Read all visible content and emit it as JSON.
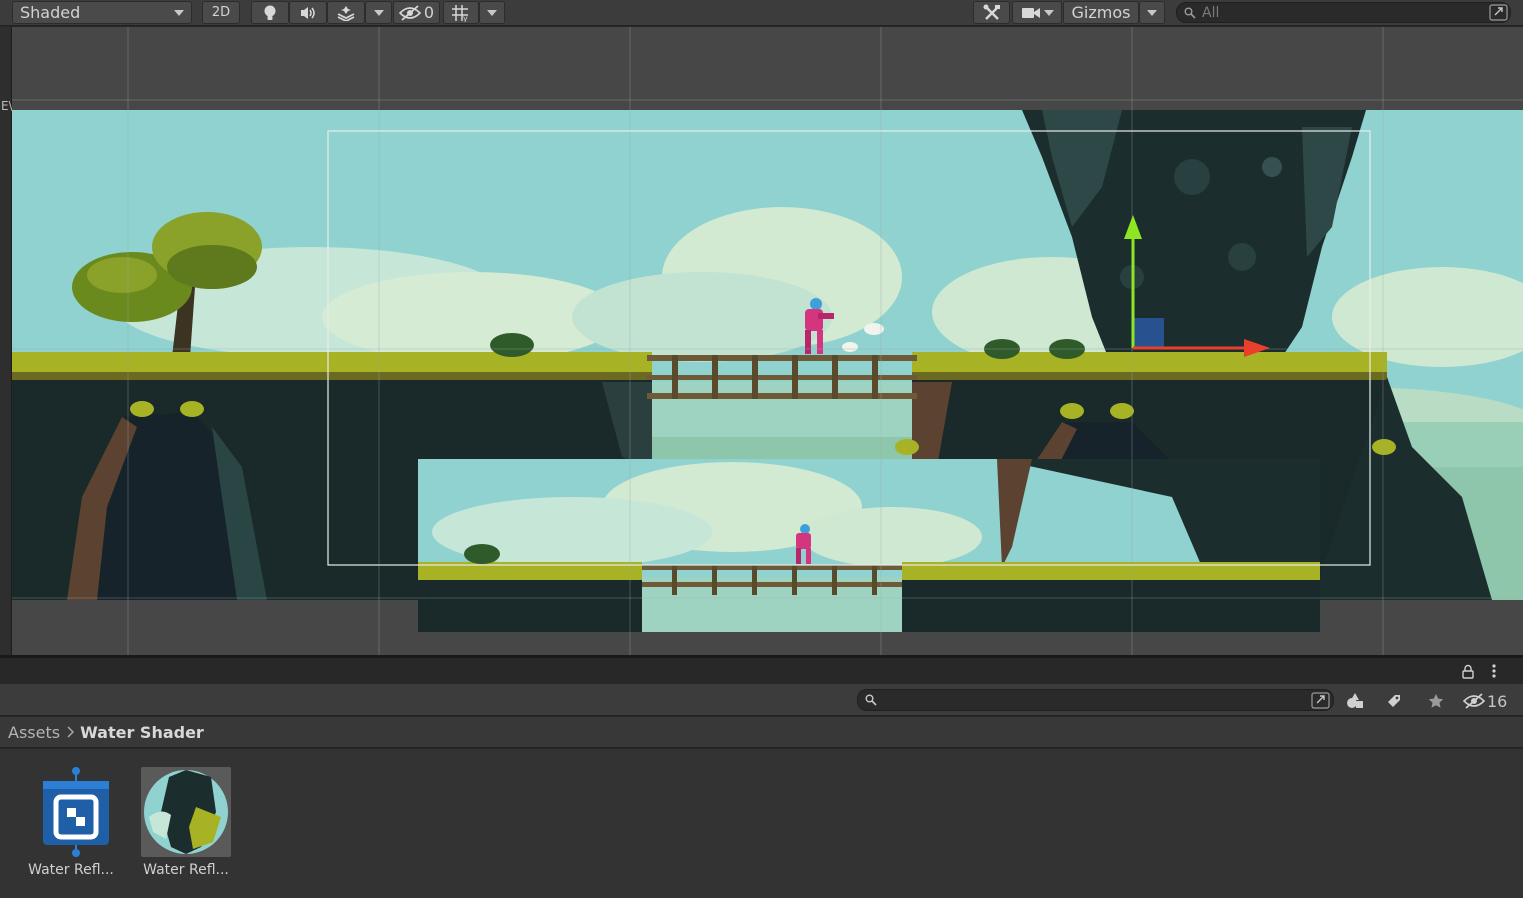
{
  "scene_toolbar": {
    "shading_mode": "Shaded",
    "mode_2d_label": "2D",
    "hidden_layers_count": "0",
    "gizmos_label": "Gizmos",
    "search_placeholder": "All"
  },
  "scene": {
    "left_edge_glyph": "E\\"
  },
  "project": {
    "search_placeholder": "",
    "hidden_count": "16",
    "breadcrumb": {
      "root": "Assets",
      "current": "Water Shader"
    },
    "assets": [
      {
        "label": "Water Refl...",
        "icon": "shader-graph-icon"
      },
      {
        "label": "Water Refl...",
        "icon": "material-sphere-icon"
      }
    ]
  },
  "colors": {
    "toolbar_bg": "#3c3c3c",
    "scene_bg": "#474747",
    "sky": "#8fd2cf",
    "grass": "#a7b225",
    "dark_rock": "#1c2d2e",
    "gizmo_y": "#8ee622",
    "gizmo_x": "#e8402c",
    "shader_blue": "#1f5fa8"
  }
}
